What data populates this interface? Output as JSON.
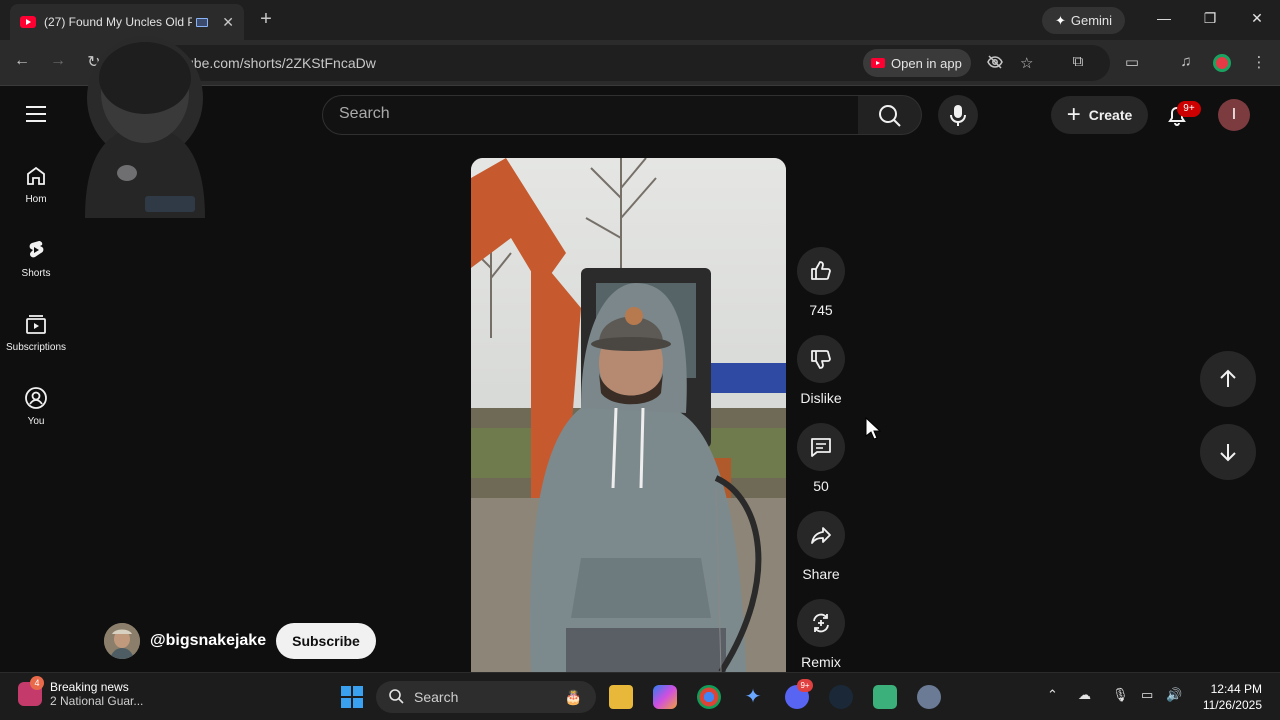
{
  "browser": {
    "tab_title": "(27) Found My Uncles Old P",
    "close_tab": "✕",
    "new_tab": "+",
    "gemini_label": "Gemini",
    "url": "ube.com/shorts/2ZKStFncaDw",
    "open_in_app": "Open in app",
    "window_controls": [
      "—",
      "❐",
      "✕"
    ]
  },
  "youtube": {
    "search_placeholder": "Search",
    "create_label": "Create",
    "notif_count": "9+",
    "account_initial": "I",
    "guide": [
      {
        "label": "Hom",
        "icon": "home-icon"
      },
      {
        "label": "Shorts",
        "icon": "shorts-icon"
      },
      {
        "label": "Subscriptions",
        "icon": "subscriptions-icon"
      },
      {
        "label": "You",
        "icon": "you-icon"
      }
    ],
    "actions": {
      "like_count": "745",
      "dislike_label": "Dislike",
      "comment_count": "50",
      "share_label": "Share",
      "remix_label": "Remix"
    },
    "channel_handle": "@bigsnakejake",
    "subscribe_label": "Subscribe"
  },
  "taskbar": {
    "news_title": "Breaking news",
    "news_sub": "2 National Guar...",
    "news_badge": "4",
    "search_label": "Search",
    "discord_badge": "9+",
    "time": "12:44 PM",
    "date": "11/26/2025"
  },
  "colors": {
    "accent_red": "#ff0033",
    "background": "#0f0f0f"
  }
}
